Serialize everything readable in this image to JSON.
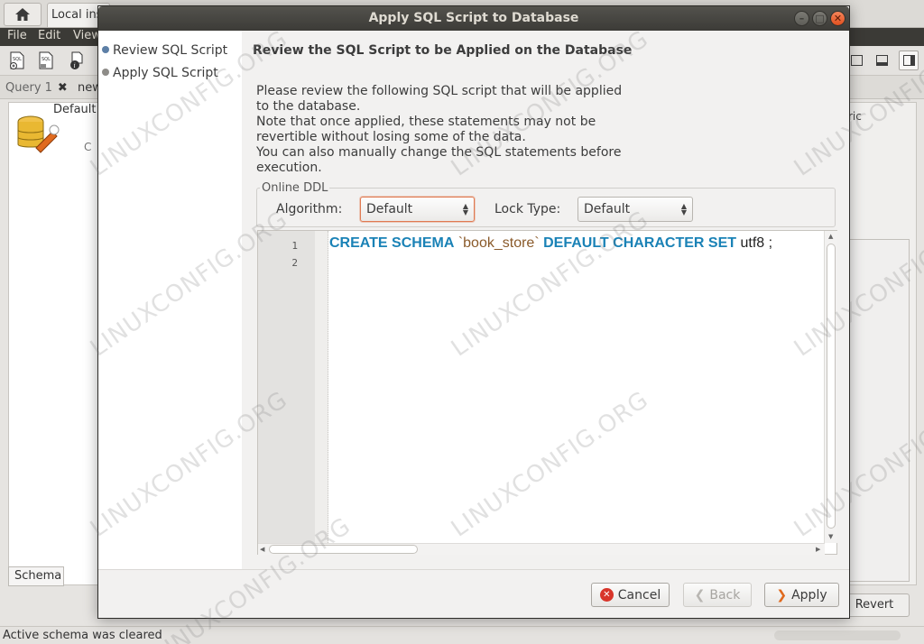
{
  "background_app": {
    "tab_label": "Local instance",
    "menu": [
      "File",
      "Edit",
      "View"
    ],
    "query_tabs": [
      "Query 1",
      "new"
    ],
    "default_label": "Default",
    "c_label": "C",
    "right_panel_text": "ric",
    "schema_tab": "Schema",
    "revert_button": "Revert",
    "status_text": "Active schema was cleared"
  },
  "dialog": {
    "title": "Apply SQL Script to Database",
    "steps": [
      "Review SQL Script",
      "Apply SQL Script"
    ],
    "heading": "Review the SQL Script to be Applied on the Database",
    "description": [
      "Please review the following SQL script that will be applied",
      "to the database.",
      "Note that once applied, these statements may not be",
      "revertible without losing some of the data.",
      "You can also manually change the SQL statements before",
      "execution."
    ],
    "online_ddl": {
      "legend": "Online DDL",
      "algorithm_label": "Algorithm:",
      "algorithm_value": "Default",
      "lock_label": "Lock Type:",
      "lock_value": "Default"
    },
    "editor": {
      "line_numbers": [
        "1",
        "2"
      ],
      "code": {
        "kw1": "CREATE SCHEMA",
        "name": "`book_store`",
        "kw2": "DEFAULT CHARACTER SET",
        "value": "utf8 ;"
      }
    },
    "buttons": {
      "cancel": "Cancel",
      "back": "Back",
      "apply": "Apply"
    }
  },
  "watermark": "LINUXCONFIG.ORG"
}
